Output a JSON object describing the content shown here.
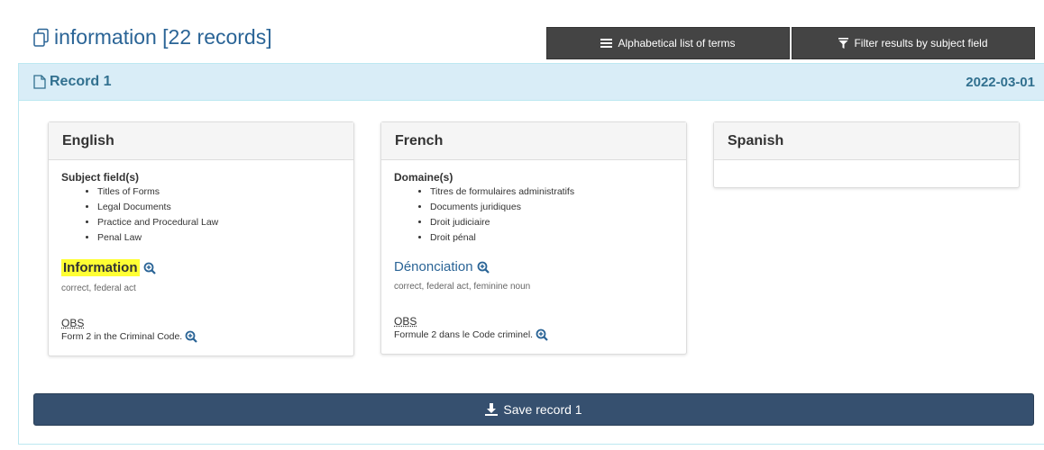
{
  "header": {
    "title": "information [22 records]",
    "alpha_label": "Alphabetical list of terms",
    "filter_label": "Filter results by subject field"
  },
  "record": {
    "title": "Record 1",
    "date": "2022-03-01",
    "save_label": "Save record 1"
  },
  "languages": {
    "english": {
      "name": "English",
      "subject_label": "Subject field(s)",
      "subjects": [
        "Titles of Forms",
        "Legal Documents",
        "Practice and Procedural Law",
        "Penal Law"
      ],
      "term": "Information",
      "term_note": "correct, federal act",
      "obs_label": "OBS",
      "obs_text": "Form 2 in the Criminal Code."
    },
    "french": {
      "name": "French",
      "subject_label": "Domaine(s)",
      "subjects": [
        "Titres de formulaires administratifs",
        "Documents juridiques",
        "Droit judiciaire",
        "Droit pénal"
      ],
      "term": "Dénonciation",
      "term_note": "correct, federal act, feminine noun",
      "obs_label": "OBS",
      "obs_text": "Formule 2 dans le Code criminel."
    },
    "spanish": {
      "name": "Spanish"
    }
  },
  "colors": {
    "title_link": "#2a6496",
    "toolbar_bg": "#444444",
    "record_header_bg": "#d9edf7",
    "highlight": "#ffff33",
    "save_bg": "#36506f"
  },
  "icons": {
    "title": "copy-icon",
    "alpha": "list-icon",
    "filter": "filter-icon",
    "record": "file-icon",
    "zoom": "zoom-in-icon",
    "save": "download-icon"
  }
}
